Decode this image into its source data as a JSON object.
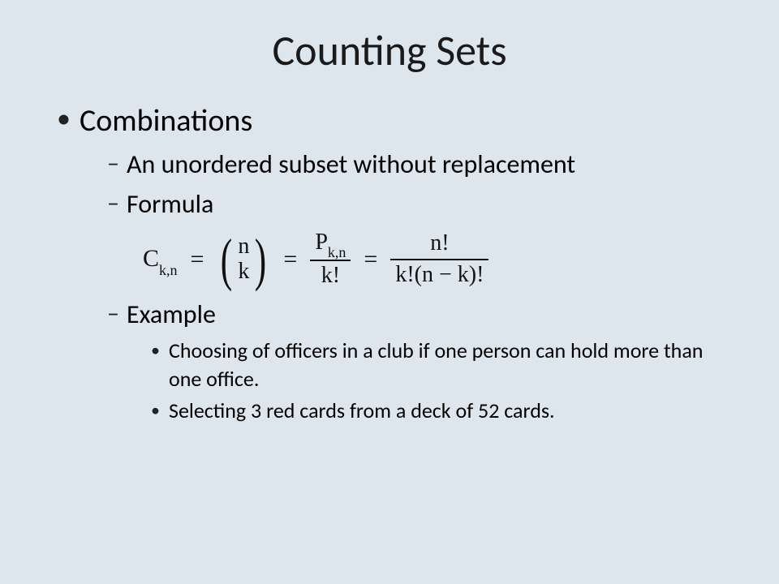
{
  "title": "Counting Sets",
  "bullet1": "Combinations",
  "sub_def": "An unordered subset without replacement",
  "sub_formula_label": "Formula",
  "sub_example_label": "Example",
  "example1": "Choosing of officers in a club if one person can hold more than one office.",
  "example2": "Selecting 3 red cards from a deck of 52 cards.",
  "formula": {
    "lhs": "C",
    "lhs_sub": "k,n",
    "eq": "=",
    "binom_top": "n",
    "binom_bottom": "k",
    "frac1_num_main": "P",
    "frac1_num_sub": "k,n",
    "frac1_den": "k!",
    "frac2_num": "n!",
    "frac2_den": "k!(n − k)!"
  }
}
